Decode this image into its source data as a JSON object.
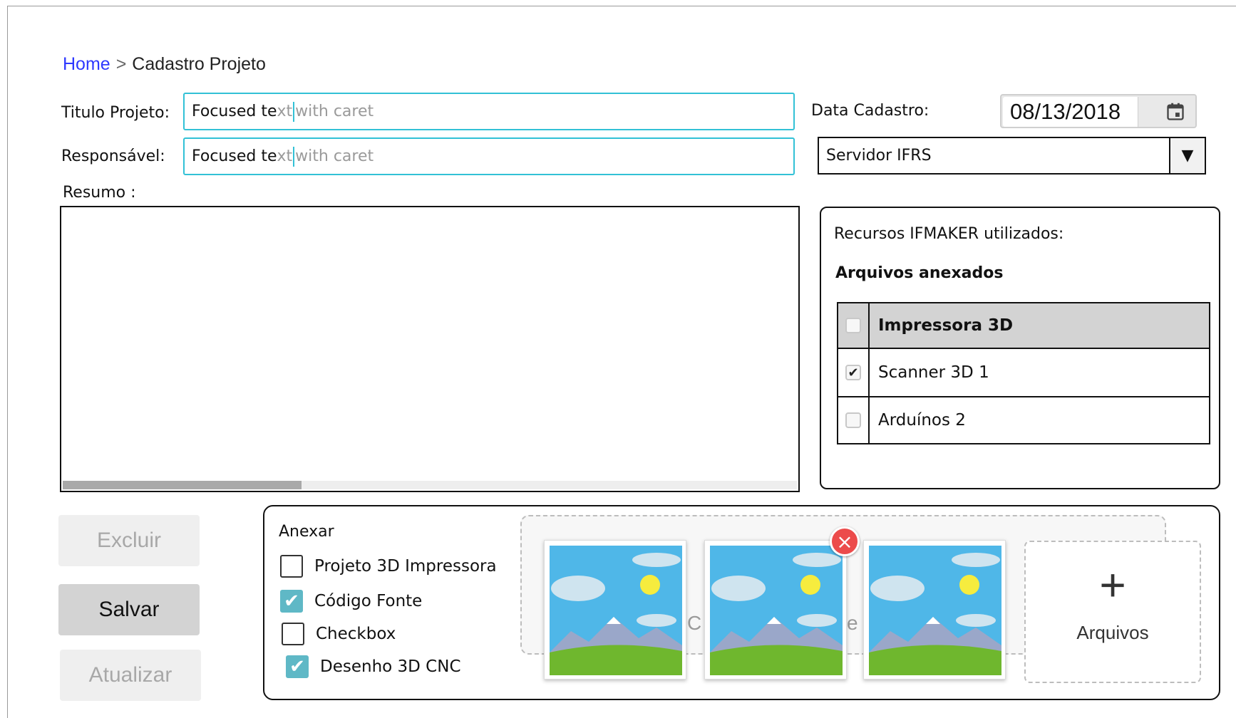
{
  "breadcrumb": {
    "home": "Home",
    "separator": ">",
    "current": "Cadastro Projeto"
  },
  "form": {
    "titulo_label": "Titulo Projeto:",
    "titulo_value_typed": "Focused te",
    "titulo_value_ghost_1": "xt ",
    "titulo_value_ghost_2": "with caret",
    "responsavel_label": "Responsável:",
    "responsavel_value_typed": "Focused te",
    "responsavel_value_ghost_1": "xt ",
    "responsavel_value_ghost_2": "with caret",
    "data_label": "Data Cadastro:",
    "data_value": "08/13/2018",
    "responsavel_select": "Servidor IFRS",
    "resumo_label": "Resumo :"
  },
  "recursos": {
    "title": "Recursos IFMAKER utilizados:",
    "subtitle": "Arquivos anexados",
    "rows": [
      {
        "label": "Impressora 3D",
        "checked": false,
        "header": true
      },
      {
        "label": "Scanner 3D 1",
        "checked": true,
        "header": false
      },
      {
        "label": "Arduínos 2",
        "checked": false,
        "header": false
      }
    ]
  },
  "buttons": {
    "excluir": "Excluir",
    "salvar": "Salvar",
    "atualizar": "Atualizar"
  },
  "anexar": {
    "title": "Anexar",
    "options": [
      {
        "label": "Projeto 3D Impressora",
        "checked": false
      },
      {
        "label": "Código Fonte",
        "checked": true
      },
      {
        "label": "Checkbox",
        "checked": false
      },
      {
        "label": "Desenho 3D CNC",
        "checked": true
      }
    ],
    "drop_text_left": "C",
    "drop_text_mid": "e",
    "add_files_icon": "+",
    "add_files_label": "Arquivos",
    "remove_icon": "×"
  },
  "icons": {
    "checkmark": "✔",
    "dropdown": "▼",
    "calendar": "calendar-icon",
    "image": "landscape-image-icon"
  },
  "colors": {
    "link": "#2f39ff",
    "focus": "#32c1d6",
    "checked": "#5fb8c6",
    "remove": "#ec4b4b"
  }
}
